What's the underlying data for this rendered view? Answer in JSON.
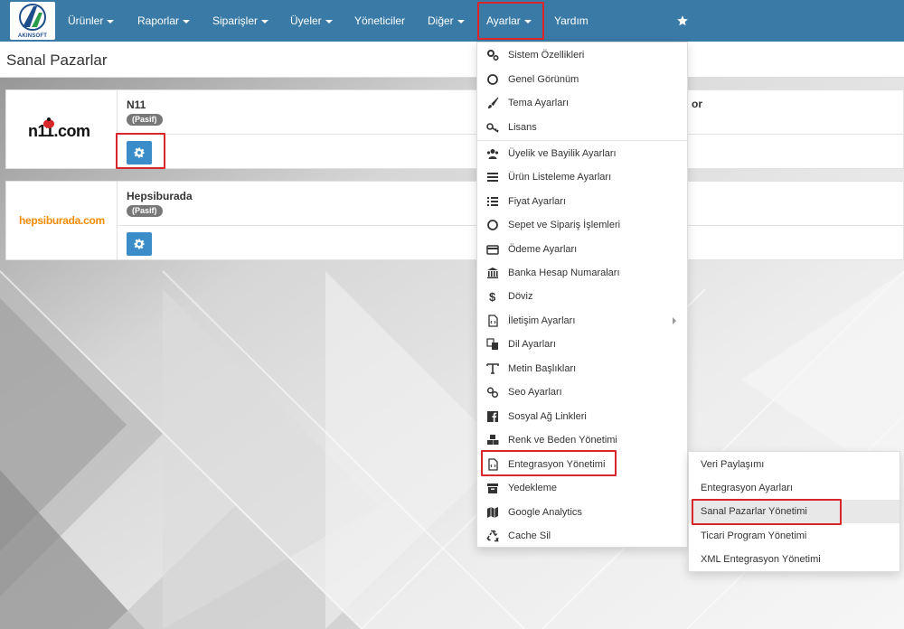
{
  "app": {
    "logo_text": "AKINSOFT"
  },
  "nav": {
    "items": [
      {
        "label": "Ürünler",
        "caret": true
      },
      {
        "label": "Raporlar",
        "caret": true
      },
      {
        "label": "Siparişler",
        "caret": true
      },
      {
        "label": "Üyeler",
        "caret": true
      },
      {
        "label": "Yöneticiler",
        "caret": false
      },
      {
        "label": "Diğer",
        "caret": true
      },
      {
        "label": "Ayarlar",
        "caret": true,
        "active": true
      },
      {
        "label": "Yardım",
        "caret": false
      }
    ],
    "star_icon": "star-icon"
  },
  "page": {
    "title": "Sanal Pazarlar"
  },
  "marketplaces": [
    {
      "name": "N11",
      "logo_text": "n11.com",
      "status": "(Pasif)"
    },
    {
      "name": "Hepsiburada",
      "logo_text": "hepsiburada.com",
      "status": "(Pasif)"
    }
  ],
  "partial_text": "or",
  "dropdown": {
    "items": [
      {
        "label": "Sistem Özellikleri",
        "icon": "cogs-icon"
      },
      {
        "label": "Genel Görünüm",
        "icon": "circle-icon"
      },
      {
        "label": "Tema Ayarları",
        "icon": "brush-icon"
      },
      {
        "label": "Lisans",
        "icon": "key-icon"
      },
      {
        "label": "Üyelik ve Bayilik Ayarları",
        "icon": "users-icon"
      },
      {
        "label": "Ürün Listeleme Ayarları",
        "icon": "list-icon"
      },
      {
        "label": "Fiyat Ayarları",
        "icon": "list-ol-icon"
      },
      {
        "label": "Sepet ve Sipariş İşlemleri",
        "icon": "circle-icon"
      },
      {
        "label": "Ödeme Ayarları",
        "icon": "credit-card-icon"
      },
      {
        "label": "Banka Hesap Numaraları",
        "icon": "bank-icon"
      },
      {
        "label": "Döviz",
        "icon": "dollar-icon"
      },
      {
        "label": "İletişim Ayarları",
        "icon": "file-code-icon",
        "submenu": true
      },
      {
        "label": "Dil Ayarları",
        "icon": "language-icon"
      },
      {
        "label": "Metin Başlıkları",
        "icon": "text-icon"
      },
      {
        "label": "Seo Ayarları",
        "icon": "link-icon"
      },
      {
        "label": "Sosyal Ağ Linkleri",
        "icon": "facebook-icon"
      },
      {
        "label": "Renk ve Beden Yönetimi",
        "icon": "cubes-icon"
      },
      {
        "label": "Entegrasyon Yönetimi",
        "icon": "file-code-icon"
      },
      {
        "label": "Yedekleme",
        "icon": "archive-icon"
      },
      {
        "label": "Google Analytics",
        "icon": "map-icon"
      },
      {
        "label": "Cache Sil",
        "icon": "recycle-icon"
      }
    ]
  },
  "submenu": {
    "items": [
      {
        "label": "Veri Paylaşımı"
      },
      {
        "label": "Entegrasyon Ayarları"
      },
      {
        "label": "Sanal Pazarlar Yönetimi",
        "active": true
      },
      {
        "label": "Ticari Program Yönetimi"
      },
      {
        "label": "XML Entegrasyon Yönetimi"
      }
    ]
  },
  "colors": {
    "navbar": "#3a7aa6",
    "button": "#3a8dc8",
    "highlight": "#d9262b",
    "badge": "#777777"
  }
}
